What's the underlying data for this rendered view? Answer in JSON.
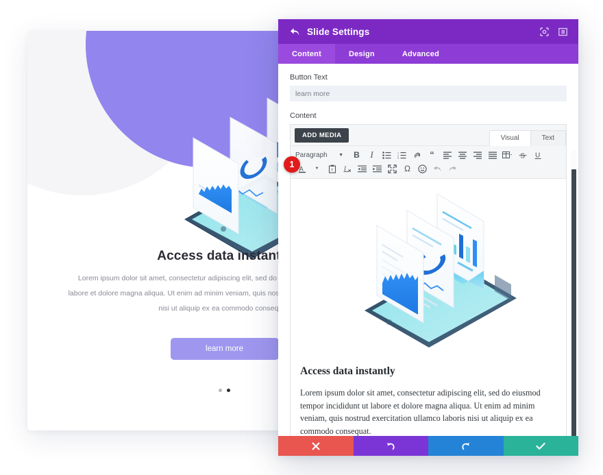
{
  "preview": {
    "title": "Access data instantly",
    "body": "Lorem ipsum dolor sit amet, consectetur adipiscing elit, sed do eiusmod tempor incididunt ut labore et dolore magna aliqua. Ut enim ad minim veniam, quis nostrud exercitation ullamco laboris nisi ut aliquip ex ea commodo consequat.",
    "button_label": "learn more",
    "button_color": "#9f97ef",
    "accent_blob_color": "#9285ee",
    "dots": [
      {
        "active": false
      },
      {
        "active": true
      }
    ]
  },
  "panel": {
    "title": "Slide Settings",
    "header_color": "#7c29c4",
    "tabbar_color": "#8e3cd6",
    "back_icon": "back-arrow-icon",
    "header_icons": [
      {
        "name": "expand-icon",
        "glyph": "⬚"
      },
      {
        "name": "layout-toggle-icon",
        "glyph": "▣"
      }
    ],
    "tabs": [
      {
        "label": "Content",
        "active": true
      },
      {
        "label": "Design",
        "active": false
      },
      {
        "label": "Advanced",
        "active": false
      }
    ],
    "fields": {
      "button_text_label": "Button Text",
      "button_text_value": "learn more",
      "button_text_placeholder": "learn more",
      "content_label": "Content"
    },
    "editor": {
      "add_media_label": "ADD MEDIA",
      "mode_tabs": [
        {
          "label": "Visual",
          "active": true
        },
        {
          "label": "Text",
          "active": false
        }
      ],
      "format_select": "Paragraph",
      "toolbar_row1": [
        {
          "name": "bold-icon",
          "glyph": "B"
        },
        {
          "name": "italic-icon",
          "glyph": "I"
        },
        {
          "name": "bulleted-list-icon",
          "glyph": ""
        },
        {
          "name": "numbered-list-icon",
          "glyph": ""
        },
        {
          "name": "link-icon",
          "glyph": ""
        },
        {
          "name": "blockquote-icon",
          "glyph": "“"
        },
        {
          "name": "align-left-icon",
          "glyph": ""
        },
        {
          "name": "align-center-icon",
          "glyph": ""
        },
        {
          "name": "align-right-icon",
          "glyph": ""
        },
        {
          "name": "align-justify-icon",
          "glyph": ""
        },
        {
          "name": "table-icon",
          "glyph": ""
        },
        {
          "name": "strikethrough-icon",
          "glyph": "S"
        },
        {
          "name": "underline-icon",
          "glyph": "U"
        }
      ],
      "toolbar_row2": [
        {
          "name": "text-color-icon",
          "glyph": "A"
        },
        {
          "name": "paste-as-text-icon",
          "glyph": ""
        },
        {
          "name": "clear-formatting-icon",
          "glyph": ""
        },
        {
          "name": "outdent-icon",
          "glyph": ""
        },
        {
          "name": "indent-icon",
          "glyph": ""
        },
        {
          "name": "fullscreen-icon",
          "glyph": ""
        },
        {
          "name": "special-character-icon",
          "glyph": "Ω"
        },
        {
          "name": "emoji-icon",
          "glyph": "☺"
        },
        {
          "name": "undo-icon",
          "glyph": ""
        },
        {
          "name": "redo-icon",
          "glyph": ""
        }
      ],
      "content_title": "Access data instantly",
      "content_body": "Lorem ipsum dolor sit amet, consectetur adipiscing elit, sed do eiusmod tempor incididunt ut labore et dolore magna aliqua. Ut enim ad minim veniam, quis nostrud exercitation ullamco laboris nisi ut aliquip ex ea commodo consequat."
    },
    "footer_buttons": [
      {
        "name": "cancel-button",
        "glyph": "✖",
        "color": "#e8564f"
      },
      {
        "name": "undo-button",
        "glyph": "↺",
        "color": "#7b35d6"
      },
      {
        "name": "redo-button",
        "glyph": "↻",
        "color": "#2483d6"
      },
      {
        "name": "save-button",
        "glyph": "✔",
        "color": "#2bb39a"
      }
    ]
  },
  "annotation": {
    "step_number": "1",
    "badge_color": "#e01b1b"
  }
}
